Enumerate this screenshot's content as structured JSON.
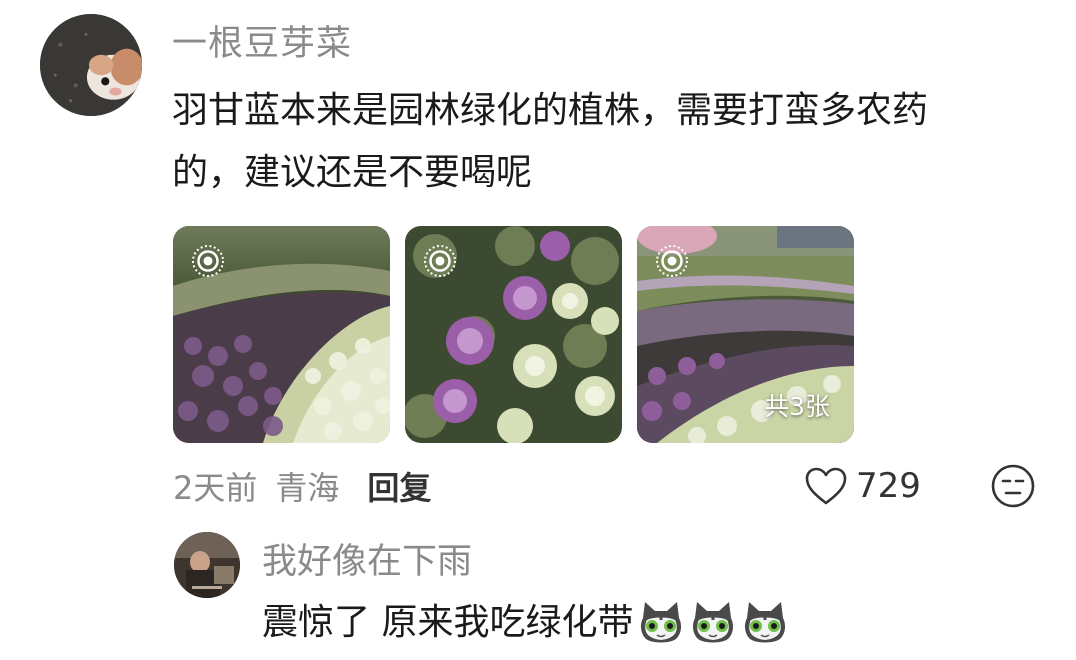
{
  "main_comment": {
    "username": "一根豆芽菜",
    "text_line1": "羽甘蓝本来是园林绿化的植株，需要打蛮多农药",
    "text_line2": "的，建议还是不要喝呢",
    "images": [
      {
        "icon": "live-photo-icon",
        "badge": ""
      },
      {
        "icon": "live-photo-icon",
        "badge": ""
      },
      {
        "icon": "live-photo-icon",
        "badge": "共3张"
      }
    ],
    "time": "2天前",
    "location": "青海",
    "reply_label": "回复",
    "like_icon": "heart-outline-icon",
    "like_count": "729",
    "reaction_icon": "neutral-face-icon"
  },
  "reply_comment": {
    "username": "我好像在下雨",
    "text": "震惊了 原来我吃绿化带",
    "emojis": [
      "cat-face-emoji",
      "cat-face-emoji",
      "cat-face-emoji"
    ]
  },
  "colors": {
    "username": "#8a8a8a",
    "text": "#1a1a1a",
    "meta": "#8a8a8a",
    "reply_link": "#333333"
  }
}
